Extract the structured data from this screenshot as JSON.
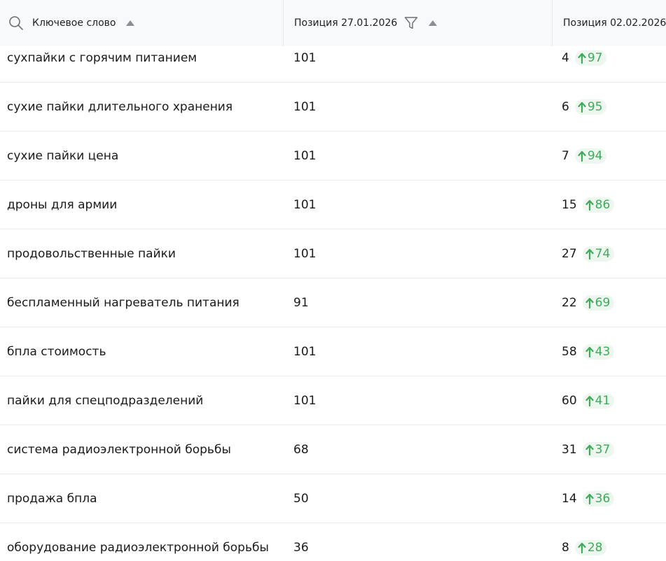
{
  "header": {
    "keyword_label": "Ключевое слово",
    "pos1_label": "Позиция 27.01.2026",
    "pos2_label": "Позиция 02.02.2026",
    "icons": {
      "search": "search-icon",
      "sort": "sort-asc-icon",
      "filter": "filter-icon",
      "delta_up": "arrow-up-icon"
    }
  },
  "colors": {
    "delta_text": "#3faa5b",
    "delta_background": "#eef7ef",
    "header_background": "#f8f9fb",
    "row_divider": "#e8eaed"
  },
  "rows": [
    {
      "keyword": "сухпайки с горячим питанием",
      "pos1": "101",
      "pos2": "4",
      "delta": "97"
    },
    {
      "keyword": "сухие пайки длительного хранения",
      "pos1": "101",
      "pos2": "6",
      "delta": "95"
    },
    {
      "keyword": "сухие пайки цена",
      "pos1": "101",
      "pos2": "7",
      "delta": "94"
    },
    {
      "keyword": "дроны для армии",
      "pos1": "101",
      "pos2": "15",
      "delta": "86"
    },
    {
      "keyword": "продовольственные пайки",
      "pos1": "101",
      "pos2": "27",
      "delta": "74"
    },
    {
      "keyword": "беспламенный нагреватель питания",
      "pos1": "91",
      "pos2": "22",
      "delta": "69"
    },
    {
      "keyword": "бпла стоимость",
      "pos1": "101",
      "pos2": "58",
      "delta": "43"
    },
    {
      "keyword": "пайки для спецподразделений",
      "pos1": "101",
      "pos2": "60",
      "delta": "41"
    },
    {
      "keyword": "система радиоэлектронной борьбы",
      "pos1": "68",
      "pos2": "31",
      "delta": "37"
    },
    {
      "keyword": "продажа бпла",
      "pos1": "50",
      "pos2": "14",
      "delta": "36"
    },
    {
      "keyword": "оборудование радиоэлектронной борьбы",
      "pos1": "36",
      "pos2": "8",
      "delta": "28"
    }
  ]
}
